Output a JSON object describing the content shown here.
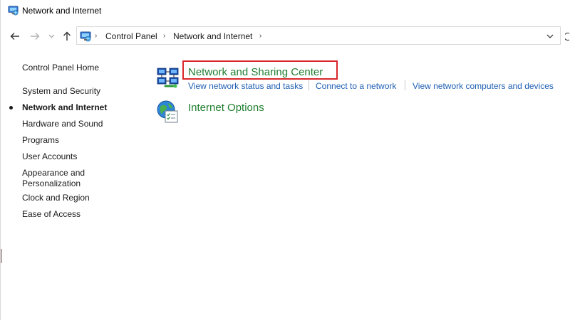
{
  "window": {
    "title": "Network and Internet"
  },
  "address_bar": {
    "crumbs": [
      "Control Panel",
      "Network and Internet"
    ]
  },
  "sidebar": {
    "items": [
      {
        "label": "Control Panel Home"
      },
      {
        "label": "System and Security"
      },
      {
        "label": "Network and Internet",
        "active": true
      },
      {
        "label": "Hardware and Sound"
      },
      {
        "label": "Programs"
      },
      {
        "label": "User Accounts"
      },
      {
        "label": "Appearance and Personalization"
      },
      {
        "label": "Clock and Region"
      },
      {
        "label": "Ease of Access"
      }
    ]
  },
  "main": {
    "categories": [
      {
        "title": "Network and Sharing Center",
        "links": [
          "View network status and tasks",
          "Connect to a network",
          "View network computers and devices"
        ]
      },
      {
        "title": "Internet Options",
        "links": []
      }
    ]
  },
  "colors": {
    "category_title": "#1e7e2e",
    "link": "#1f5fb4",
    "highlight_border": "#d9262b"
  }
}
